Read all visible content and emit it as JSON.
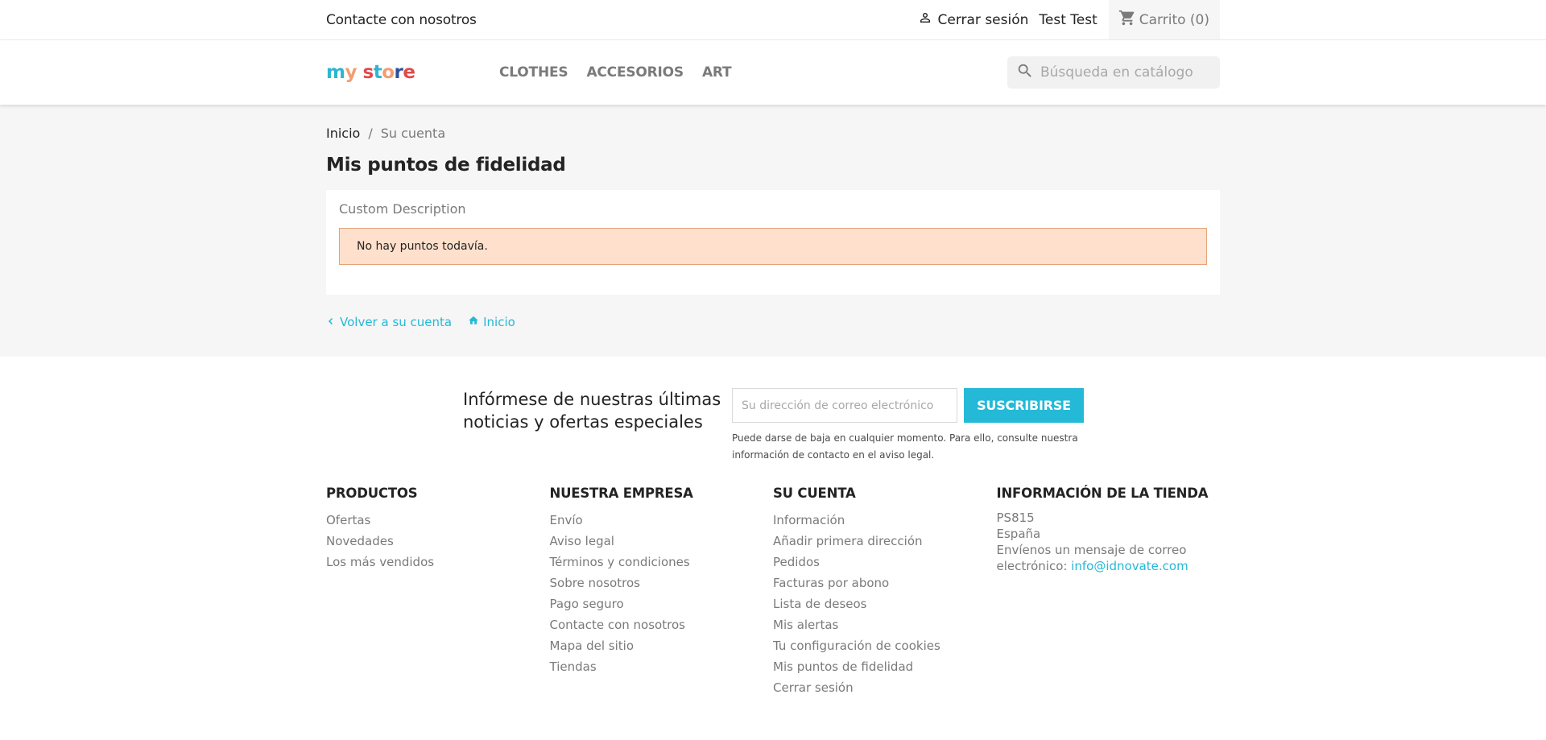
{
  "topbar": {
    "contact": "Contacte con nosotros",
    "signout": "Cerrar sesión",
    "username": "Test Test",
    "cart": "Carrito (0)"
  },
  "header": {
    "logo": "my store",
    "menu": [
      "CLOTHES",
      "ACCESORIOS",
      "ART"
    ],
    "search_placeholder": "Búsqueda en catálogo"
  },
  "breadcrumb": {
    "home": "Inicio",
    "separator": "/",
    "current": "Su cuenta"
  },
  "page": {
    "title": "Mis puntos de fidelidad",
    "description": "Custom Description",
    "alert": "No hay puntos todavía.",
    "back_link": "Volver a su cuenta",
    "home_link": "Inicio"
  },
  "newsletter": {
    "title": "Infórmese de nuestras últimas noticias y ofertas especiales",
    "placeholder": "Su dirección de correo electrónico",
    "button": "SUSCRIBIRSE",
    "note": "Puede darse de baja en cualquier momento. Para ello, consulte nuestra información de contacto en el aviso legal."
  },
  "footer": {
    "products": {
      "title": "PRODUCTOS",
      "links": [
        "Ofertas",
        "Novedades",
        "Los más vendidos"
      ]
    },
    "company": {
      "title": "NUESTRA EMPRESA",
      "links": [
        "Envío",
        "Aviso legal",
        "Términos y condiciones",
        "Sobre nosotros",
        "Pago seguro",
        "Contacte con nosotros",
        "Mapa del sitio",
        "Tiendas"
      ]
    },
    "account": {
      "title": "SU CUENTA",
      "links": [
        "Información",
        "Añadir primera dirección",
        "Pedidos",
        "Facturas por abono",
        "Lista de deseos",
        "Mis alertas",
        "Tu configuración de cookies",
        "Mis puntos de fidelidad",
        "Cerrar sesión"
      ]
    },
    "store": {
      "title": "INFORMACIÓN DE LA TIENDA",
      "name": "PS815",
      "country": "España",
      "email_label": "Envíenos un mensaje de correo electrónico:",
      "email": "info@idnovate.com"
    }
  },
  "colors": {
    "accent": "#24b9d7",
    "alert_bg": "#ffe0cc",
    "alert_border": "#e3a47a",
    "page_bg": "#f6f6f6"
  }
}
